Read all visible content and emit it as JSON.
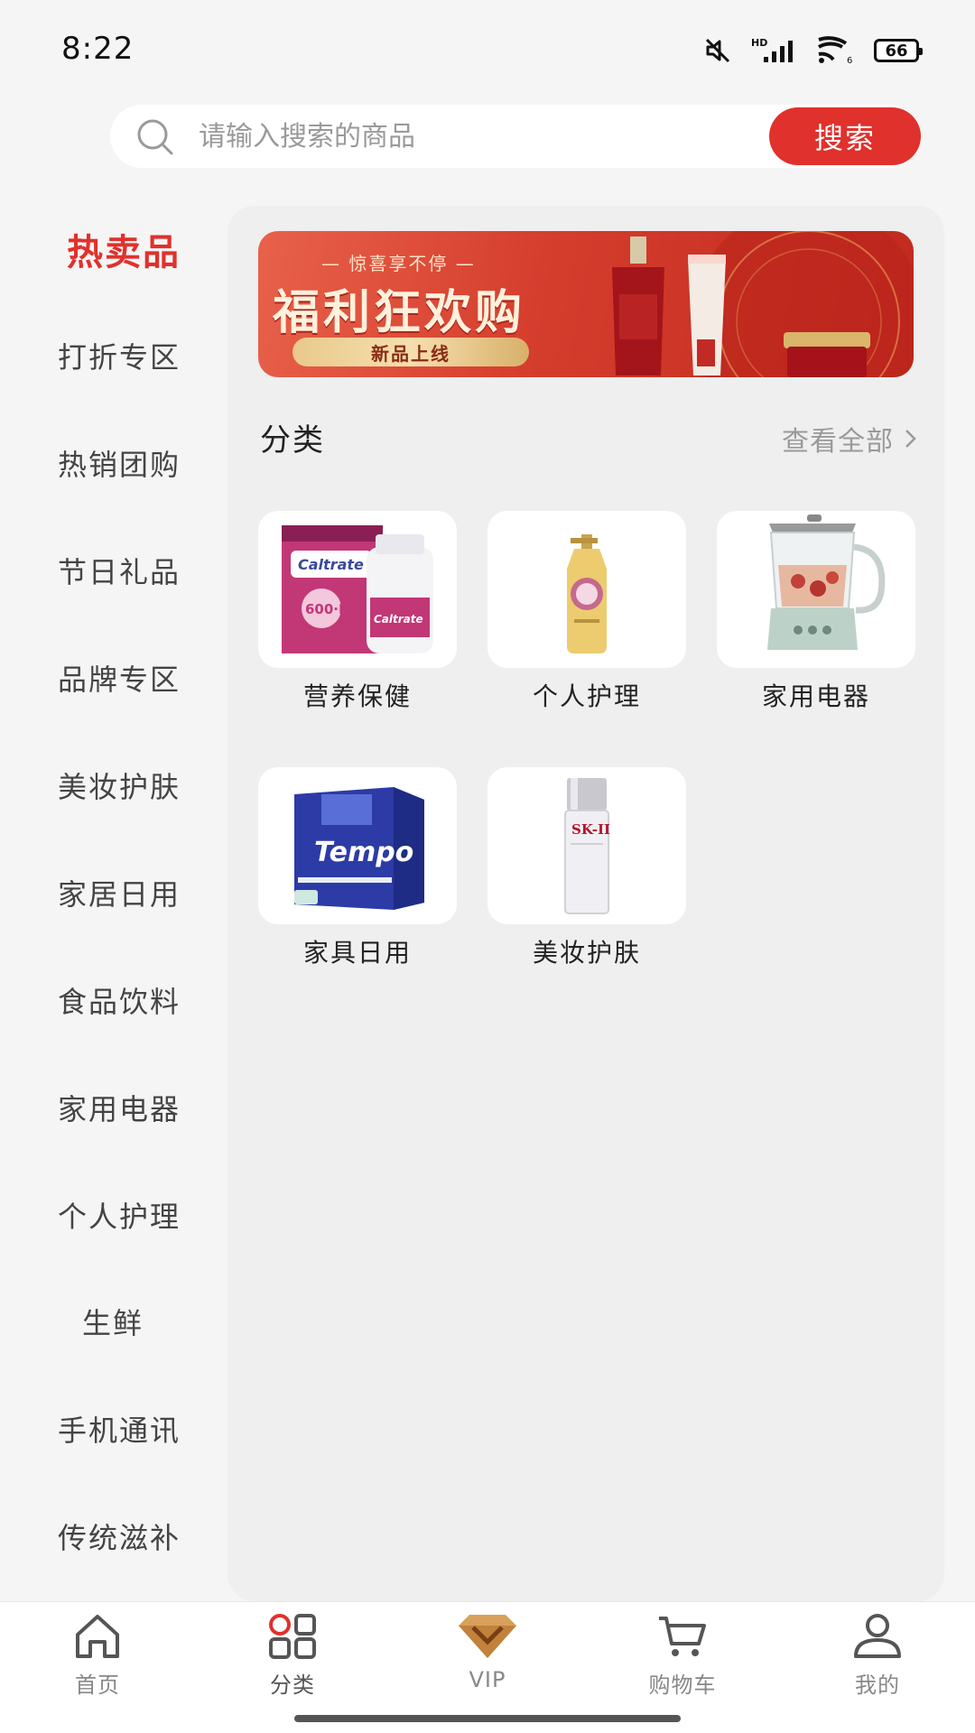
{
  "status_bar": {
    "time": "8:22",
    "battery": "66",
    "network": "HD"
  },
  "search": {
    "placeholder": "请输入搜索的商品",
    "button_label": "搜索"
  },
  "sidebar": {
    "items": [
      {
        "label": "热卖品",
        "active": true
      },
      {
        "label": "打折专区"
      },
      {
        "label": "热销团购"
      },
      {
        "label": "节日礼品"
      },
      {
        "label": "品牌专区"
      },
      {
        "label": "美妆护肤"
      },
      {
        "label": "家居日用"
      },
      {
        "label": "食品饮料"
      },
      {
        "label": "家用电器"
      },
      {
        "label": "个人护理"
      },
      {
        "label": "生鲜"
      },
      {
        "label": "手机通讯"
      },
      {
        "label": "传统滋补"
      }
    ]
  },
  "banner": {
    "subtitle": "— 惊喜享不停 —",
    "title": "福利狂欢购",
    "pill": "新品上线"
  },
  "categories_section": {
    "title": "分类",
    "view_all": "查看全部"
  },
  "categories": [
    {
      "label": "营养保健",
      "image": "calcium-supplement-product"
    },
    {
      "label": "个人护理",
      "image": "body-wash-bottle"
    },
    {
      "label": "家用电器",
      "image": "health-kettle"
    },
    {
      "label": "家具日用",
      "image": "tissue-box",
      "image_text": "Tempo"
    },
    {
      "label": "美妆护肤",
      "image": "essence-bottle",
      "image_text": "SK-II"
    }
  ],
  "bottom_nav": {
    "items": [
      {
        "label": "首页",
        "icon": "home-icon"
      },
      {
        "label": "分类",
        "icon": "category-grid-icon",
        "active": true
      },
      {
        "label": "VIP",
        "icon": "vip-diamond-icon"
      },
      {
        "label": "购物车",
        "icon": "cart-icon"
      },
      {
        "label": "我的",
        "icon": "user-icon"
      }
    ]
  },
  "colors": {
    "accent": "#e0312c",
    "background": "#f5f5f5",
    "panel": "#efefef"
  }
}
